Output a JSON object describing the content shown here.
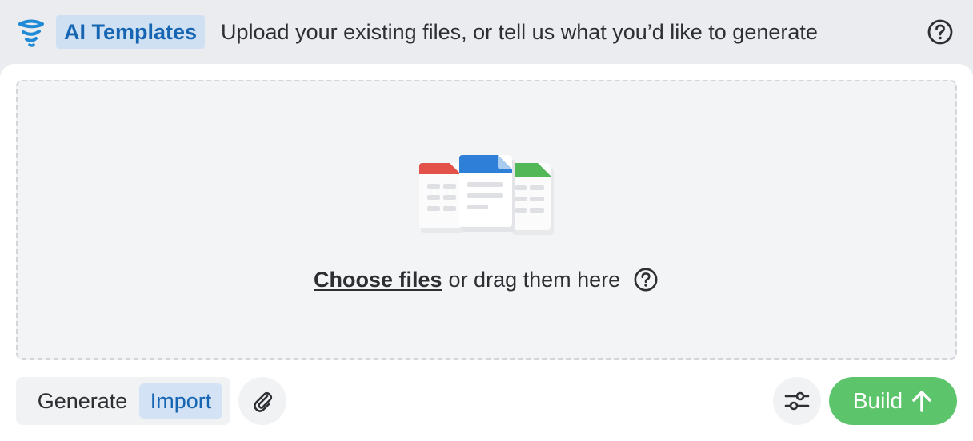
{
  "header": {
    "logo_icon": "tornado-logo-icon",
    "badge_label": "AI Templates",
    "subtitle": "Upload your existing files, or tell us what you’d like to generate",
    "help_icon": "question-circle-icon"
  },
  "dropzone": {
    "illustration": "document-files-icon",
    "choose_link": "Choose files",
    "drag_text": "or drag them here",
    "help_icon": "question-circle-icon"
  },
  "footer": {
    "modes": [
      "Generate",
      "Import"
    ],
    "active_mode": "Import",
    "attach_icon": "paperclip-icon",
    "settings_icon": "sliders-icon",
    "build_label": "Build",
    "build_icon": "arrow-up-icon"
  },
  "colors": {
    "accent_blue": "#1565b3",
    "badge_bg": "#cfe0f3",
    "build_green": "#5cc46a",
    "header_bg": "#eaecef"
  }
}
